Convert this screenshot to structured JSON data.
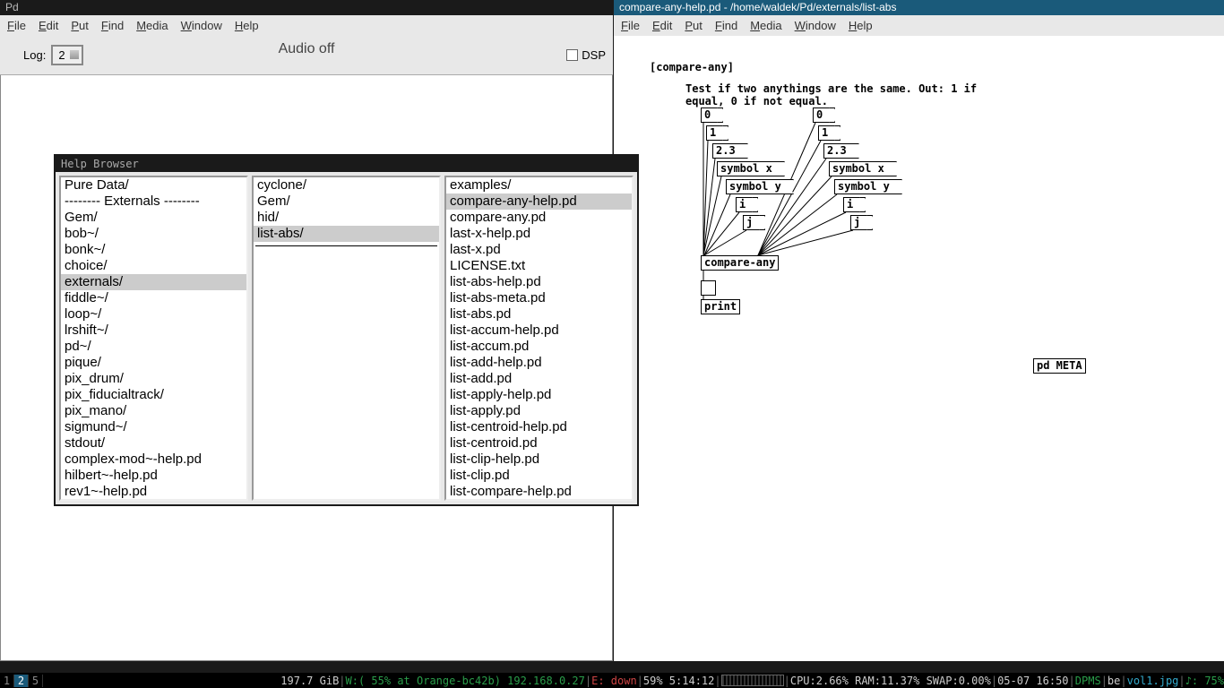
{
  "pd_main": {
    "title": "Pd",
    "menu": [
      "File",
      "Edit",
      "Put",
      "Find",
      "Media",
      "Window",
      "Help"
    ],
    "log_label": "Log:",
    "log_value": "2",
    "audio_label": "Audio off",
    "dsp_label": "DSP"
  },
  "patch": {
    "title": "compare-any-help.pd  - /home/waldek/Pd/externals/list-abs",
    "menu": [
      "File",
      "Edit",
      "Put",
      "Find",
      "Media",
      "Window",
      "Help"
    ],
    "header": "[compare-any]",
    "desc": "Test if two anythings are the same. Out: 1 if equal, 0 if not equal.",
    "meta": "pd META",
    "compare": "compare-any",
    "print": "print",
    "left_msgs": [
      "0",
      "1",
      "2.3",
      "symbol x",
      "symbol y",
      "i",
      "j"
    ],
    "right_msgs": [
      "0",
      "1",
      "2.3",
      "symbol x",
      "symbol y",
      "i",
      "j"
    ]
  },
  "help_browser": {
    "title": "Help Browser",
    "col1": [
      {
        "t": " Pure Data/",
        "s": false
      },
      {
        "t": "-------- Externals --------",
        "s": false
      },
      {
        "t": "Gem/",
        "s": false
      },
      {
        "t": "bob~/",
        "s": false
      },
      {
        "t": "bonk~/",
        "s": false
      },
      {
        "t": "choice/",
        "s": false
      },
      {
        "t": "externals/",
        "s": true
      },
      {
        "t": "fiddle~/",
        "s": false
      },
      {
        "t": "loop~/",
        "s": false
      },
      {
        "t": "lrshift~/",
        "s": false
      },
      {
        "t": "pd~/",
        "s": false
      },
      {
        "t": "pique/",
        "s": false
      },
      {
        "t": "pix_drum/",
        "s": false
      },
      {
        "t": "pix_fiducialtrack/",
        "s": false
      },
      {
        "t": "pix_mano/",
        "s": false
      },
      {
        "t": "sigmund~/",
        "s": false
      },
      {
        "t": "stdout/",
        "s": false
      },
      {
        "t": "complex-mod~-help.pd",
        "s": false
      },
      {
        "t": "hilbert~-help.pd",
        "s": false
      },
      {
        "t": "rev1~-help.pd",
        "s": false
      }
    ],
    "col2": [
      {
        "t": "cyclone/",
        "s": false
      },
      {
        "t": "Gem/",
        "s": false
      },
      {
        "t": "hid/",
        "s": false
      },
      {
        "t": "list-abs/",
        "s": true
      }
    ],
    "col3": [
      {
        "t": "examples/",
        "s": false
      },
      {
        "t": "compare-any-help.pd",
        "s": true
      },
      {
        "t": "compare-any.pd",
        "s": false
      },
      {
        "t": "last-x-help.pd",
        "s": false
      },
      {
        "t": "last-x.pd",
        "s": false
      },
      {
        "t": "LICENSE.txt",
        "s": false
      },
      {
        "t": "list-abs-help.pd",
        "s": false
      },
      {
        "t": "list-abs-meta.pd",
        "s": false
      },
      {
        "t": "list-abs.pd",
        "s": false
      },
      {
        "t": "list-accum-help.pd",
        "s": false
      },
      {
        "t": "list-accum.pd",
        "s": false
      },
      {
        "t": "list-add-help.pd",
        "s": false
      },
      {
        "t": "list-add.pd",
        "s": false
      },
      {
        "t": "list-apply-help.pd",
        "s": false
      },
      {
        "t": "list-apply.pd",
        "s": false
      },
      {
        "t": "list-centroid-help.pd",
        "s": false
      },
      {
        "t": "list-centroid.pd",
        "s": false
      },
      {
        "t": "list-clip-help.pd",
        "s": false
      },
      {
        "t": "list-clip.pd",
        "s": false
      },
      {
        "t": "list-compare-help.pd",
        "s": false
      }
    ]
  },
  "statusbar": {
    "workspaces": [
      "1",
      "2",
      "5"
    ],
    "active_ws": 1,
    "disk": "197.7 GiB",
    "wifi_label": "W:",
    "wifi": "( 55% at Orange-bc42b) 192.168.0.27",
    "eth_label": "E:",
    "eth": "down",
    "battery": "59% 5:14:12",
    "cpu": "CPU:2.66% RAM:11.37% SWAP:0.00%",
    "date": "05-07 16:50",
    "dpms": "DPMS",
    "kb": "be",
    "vol": "vol1.jpg",
    "music": "♪: 75%"
  }
}
